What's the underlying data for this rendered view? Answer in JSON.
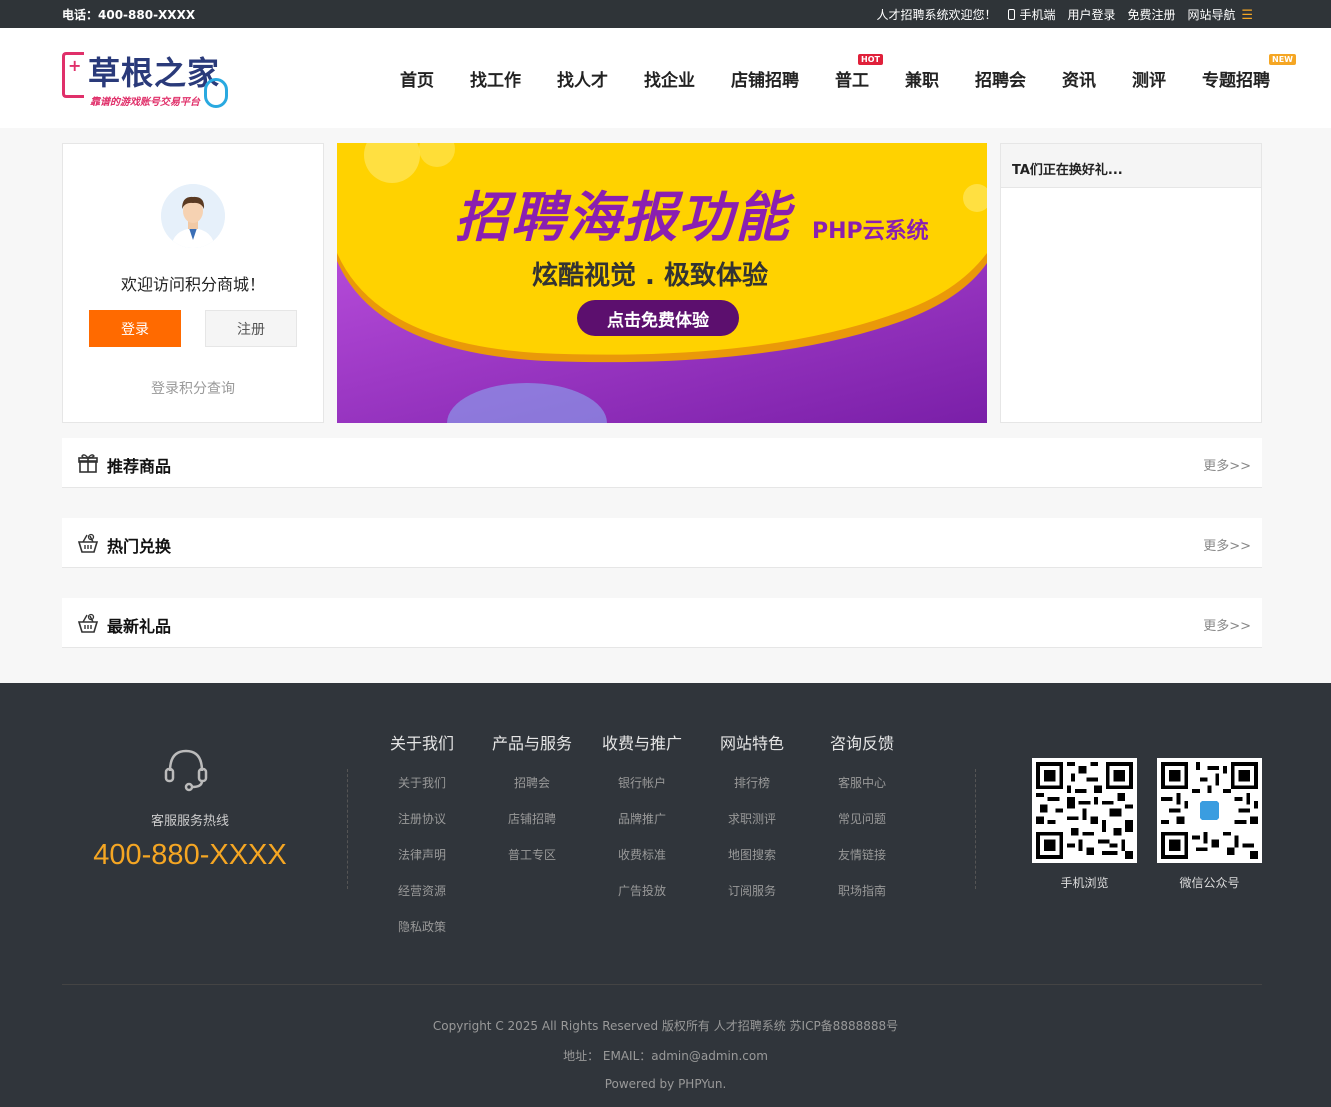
{
  "topbar": {
    "phone": "电话：400-880-XXXX",
    "welcome": "人才招聘系统欢迎您！",
    "mobile": "手机端",
    "login": "用户登录",
    "register": "免费注册",
    "sitenav": "网站导航"
  },
  "logo": {
    "main": "草根之家",
    "sub": "靠谱的游戏账号交易平台"
  },
  "nav": [
    {
      "label": "首页"
    },
    {
      "label": "找工作"
    },
    {
      "label": "找人才"
    },
    {
      "label": "找企业"
    },
    {
      "label": "店铺招聘"
    },
    {
      "label": "普工",
      "badge": "HOT"
    },
    {
      "label": "兼职"
    },
    {
      "label": "招聘会"
    },
    {
      "label": "资讯"
    },
    {
      "label": "测评"
    },
    {
      "label": "专题招聘",
      "badge": "NEW"
    }
  ],
  "userpanel": {
    "welcome": "欢迎访问积分商城！",
    "login_btn": "登录",
    "register_btn": "注册",
    "query_link": "登录积分查询"
  },
  "banner": {
    "title": "招聘海报功能",
    "brand": "PHP云系统",
    "slogan": "炫酷视觉 . 极致体验",
    "cta": "点击免费体验"
  },
  "exchange_panel": {
    "title": "TA们正在换好礼..."
  },
  "sections": [
    {
      "title": "推荐商品",
      "more": "更多>>",
      "icon": "gift-icon"
    },
    {
      "title": "热门兑换",
      "more": "更多>>",
      "icon": "basket-icon"
    },
    {
      "title": "最新礼品",
      "more": "更多>>",
      "icon": "basket-icon"
    }
  ],
  "footer": {
    "hotline_label": "客服服务热线",
    "hotline_number": "400-880-XXXX",
    "columns": [
      {
        "title": "关于我们",
        "links": [
          "关于我们",
          "注册协议",
          "法律声明",
          "经营资源",
          "隐私政策"
        ]
      },
      {
        "title": "产品与服务",
        "links": [
          "招聘会",
          "店铺招聘",
          "普工专区"
        ]
      },
      {
        "title": "收费与推广",
        "links": [
          "银行帐户",
          "品牌推广",
          "收费标准",
          "广告投放"
        ]
      },
      {
        "title": "网站特色",
        "links": [
          "排行榜",
          "求职测评",
          "地图搜索",
          "订阅服务"
        ]
      },
      {
        "title": "咨询反馈",
        "links": [
          "客服中心",
          "常见问题",
          "友情链接",
          "职场指南"
        ]
      }
    ],
    "qr1_label": "手机浏览",
    "qr2_label": "微信公众号",
    "copyright": "Copyright C 2025 All Rights Reserved 版权所有 人才招聘系统 苏ICP备8888888号",
    "address": "地址：  EMAIL：admin@admin.com",
    "powered": "Powered by PHPYun."
  },
  "colors": {
    "accent": "#ff6a00",
    "hotline": "#f5a623",
    "footer_bg": "#30353b",
    "topbar_bg": "#2f3438",
    "banner_bg": "#ffd200",
    "banner_title": "#8a1fb1"
  }
}
